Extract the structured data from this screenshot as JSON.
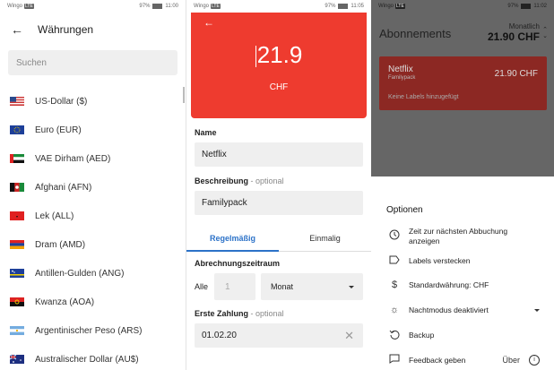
{
  "status": {
    "carrier": "Wingo",
    "net": "LTE",
    "battery": "97%",
    "time1": "11:00",
    "time2": "11:05",
    "time3": "11:02"
  },
  "currencies": {
    "title": "Währungen",
    "search_placeholder": "Suchen",
    "items": [
      {
        "label": "US-Dollar ($)",
        "flag": "us-flag"
      },
      {
        "label": "Euro (EUR)",
        "flag": "eu-flag"
      },
      {
        "label": "VAE Dirham (AED)",
        "flag": "ae-flag"
      },
      {
        "label": "Afghani (AFN)",
        "flag": "af-flag"
      },
      {
        "label": "Lek (ALL)",
        "flag": "al-flag"
      },
      {
        "label": "Dram (AMD)",
        "flag": "am-flag"
      },
      {
        "label": "Antillen-Gulden (ANG)",
        "flag": "cw-flag"
      },
      {
        "label": "Kwanza (AOA)",
        "flag": "ao-flag"
      },
      {
        "label": "Argentinischer Peso (ARS)",
        "flag": "ar-flag"
      },
      {
        "label": "Australischer Dollar (AU$)",
        "flag": "au-flag"
      }
    ]
  },
  "edit": {
    "amount": "21.9",
    "currency": "CHF",
    "name_label": "Name",
    "name_value": "Netflix",
    "desc_label": "Beschreibung",
    "desc_optional": " - optional",
    "desc_value": "Familypack",
    "tab_regular": "Regelmäßig",
    "tab_once": "Einmalig",
    "period_label": "Abrechnungszeitraum",
    "every": "Alle",
    "interval": "1",
    "unit": "Monat",
    "first_label": "Erste Zahlung",
    "first_optional": " - optional",
    "first_value": "01.02.20"
  },
  "subscriptions": {
    "title": "Abonnements",
    "monthly_label": "Monatlich",
    "monthly_total": "21.90 CHF",
    "card": {
      "name": "Netflix",
      "desc": "Familypack",
      "amount": "21.90 CHF",
      "labels": "Keine Labels hinzugefügt",
      "color": "#8c2823"
    },
    "options": {
      "title": "Optionen",
      "items": [
        {
          "label": "Zeit zur nächsten Abbuchung anzeigen",
          "icon": "clock-icon"
        },
        {
          "label": "Labels verstecken",
          "icon": "label-icon"
        },
        {
          "label": "Standardwährung: CHF",
          "icon": "dollar-icon"
        },
        {
          "label": "Nachtmodus deaktiviert",
          "icon": "sun-icon"
        },
        {
          "label": "Backup",
          "icon": "restore-icon"
        },
        {
          "label": "Feedback geben",
          "icon": "feedback-icon"
        }
      ],
      "about": "Über"
    }
  },
  "colors": {
    "accent_red": "#ee3b2f",
    "accent_blue": "#2c72c8"
  }
}
